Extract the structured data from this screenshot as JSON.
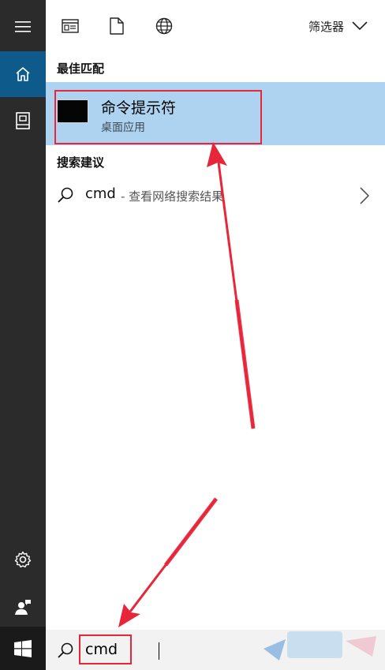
{
  "toolbar": {
    "filter_label": "筛选器",
    "icons": [
      "apps-icon",
      "documents-icon",
      "web-globe-icon"
    ]
  },
  "best_match": {
    "heading": "最佳匹配",
    "app_name": "命令提示符",
    "app_type": "桌面应用"
  },
  "suggestions": {
    "heading": "搜索建议",
    "items": [
      {
        "term": "cmd",
        "hint": "- 查看网络搜索结果"
      }
    ]
  },
  "search": {
    "value": "cmd"
  },
  "colors": {
    "rail_bg": "#2b2b2b",
    "rail_active": "#0e5a8a",
    "highlight": "#aed3f0",
    "annotation_red": "#e8263a"
  }
}
